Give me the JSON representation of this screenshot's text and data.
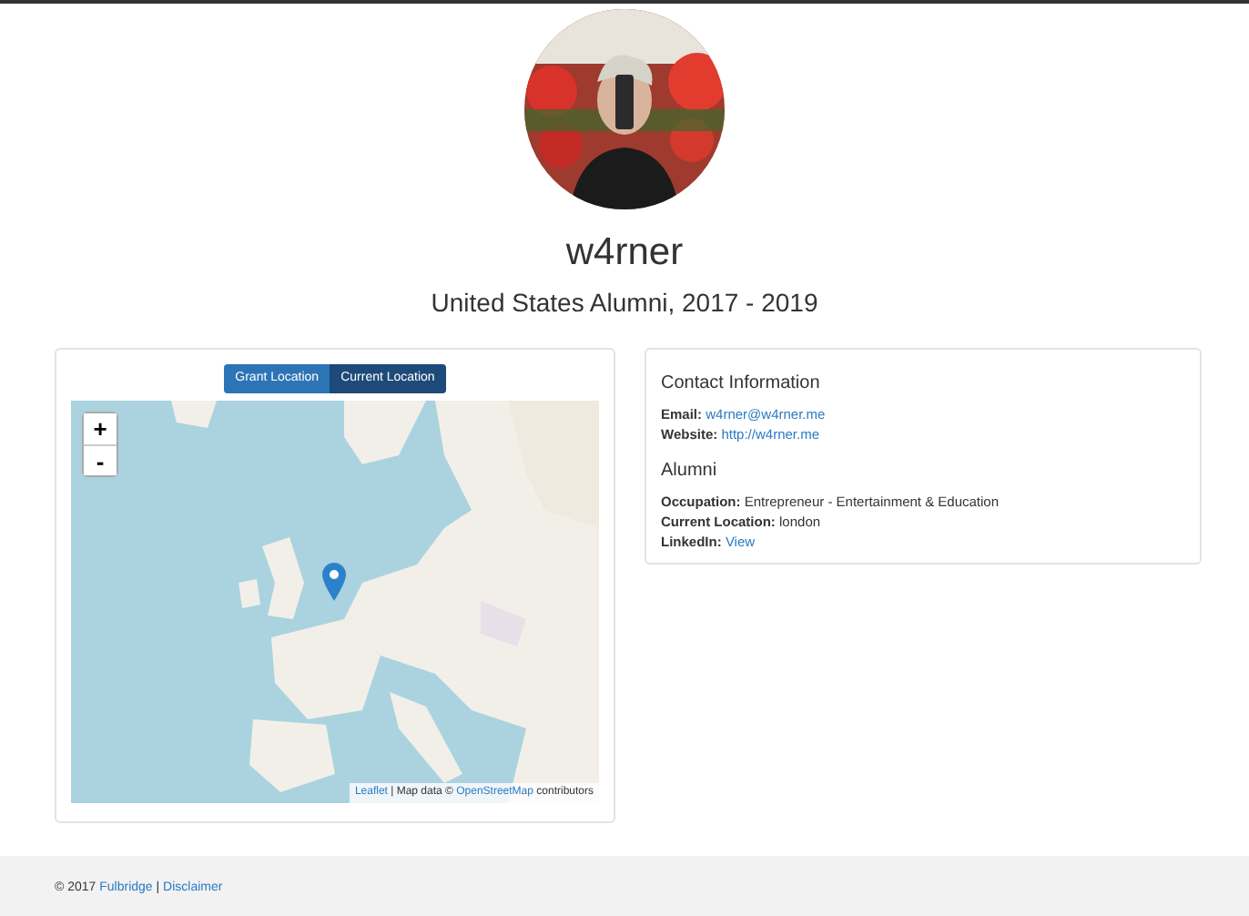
{
  "name": "w4rner",
  "subtitle": "United States Alumni, 2017 - 2019",
  "map": {
    "buttons": [
      {
        "label": "Grant Location",
        "selected": false
      },
      {
        "label": "Current Location",
        "selected": true
      }
    ],
    "zoom": [
      "+",
      "-"
    ],
    "attribution": [
      {
        "text": "Leaflet",
        "kind": "link"
      },
      {
        "text": " | Map data © ",
        "kind": "text"
      },
      {
        "text": "OpenStreetMap",
        "kind": "link"
      },
      {
        "text": " contributors",
        "kind": "text"
      }
    ]
  },
  "sections": [
    {
      "title": "Contact Information",
      "fields": [
        {
          "label": "Email:",
          "value": "w4rner@w4rner.me",
          "kind": "link"
        },
        {
          "label": "Website:",
          "value": "http://w4rner.me",
          "kind": "link"
        }
      ]
    },
    {
      "title": "Alumni",
      "fields": [
        {
          "label": "Occupation:",
          "value": "Entrepreneur - Entertainment & Education",
          "kind": "text"
        },
        {
          "label": "Current Location:",
          "value": "london",
          "kind": "text"
        },
        {
          "label": "LinkedIn:",
          "value": "View",
          "kind": "link"
        }
      ]
    }
  ],
  "footer": [
    {
      "text": "© 2017 ",
      "kind": "text"
    },
    {
      "text": "Fulbridge",
      "kind": "link"
    },
    {
      "text": " | ",
      "kind": "text"
    },
    {
      "text": "Disclaimer",
      "kind": "link"
    }
  ]
}
